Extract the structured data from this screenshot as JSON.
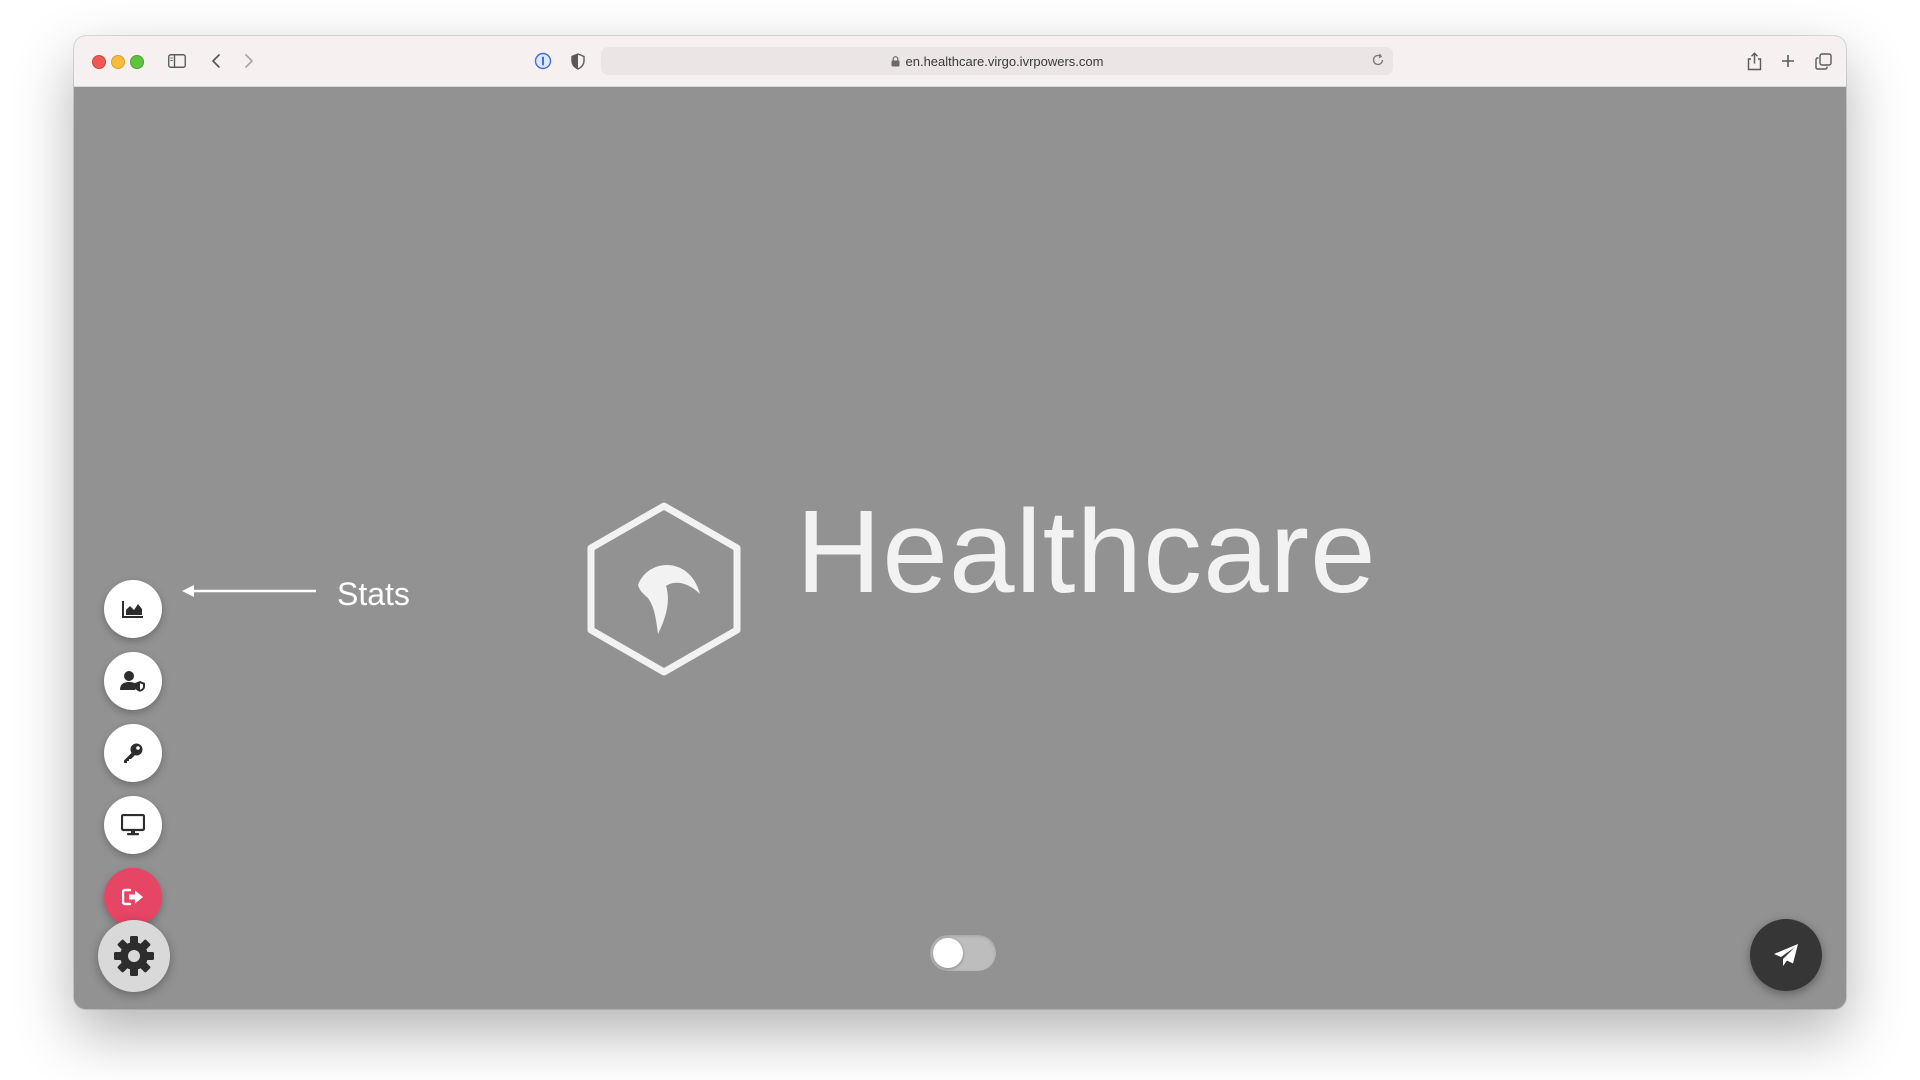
{
  "browser": {
    "url": "en.healthcare.virgo.ivrpowers.com",
    "icons": [
      "sidebar-toggle-icon",
      "back-icon",
      "forward-icon",
      "password-manager-icon",
      "privacy-shield-icon",
      "lock-icon",
      "reload-icon",
      "share-icon",
      "new-tab-icon",
      "tab-overview-icon"
    ]
  },
  "app": {
    "brand_name": "Healthcare",
    "annotation_label": "Stats",
    "buttons": [
      {
        "name": "stats",
        "icon": "area-chart-icon"
      },
      {
        "name": "user-security",
        "icon": "user-shield-icon"
      },
      {
        "name": "keys",
        "icon": "key-icon"
      },
      {
        "name": "display",
        "icon": "monitor-icon"
      },
      {
        "name": "logout",
        "icon": "logout-icon"
      },
      {
        "name": "settings",
        "icon": "gear-icon"
      },
      {
        "name": "send",
        "icon": "paper-plane-icon"
      }
    ],
    "toggle_on": false,
    "colors": {
      "background": "#929292",
      "logout": "#e64564",
      "send": "#363636",
      "settings": "#d9d9d9"
    }
  }
}
